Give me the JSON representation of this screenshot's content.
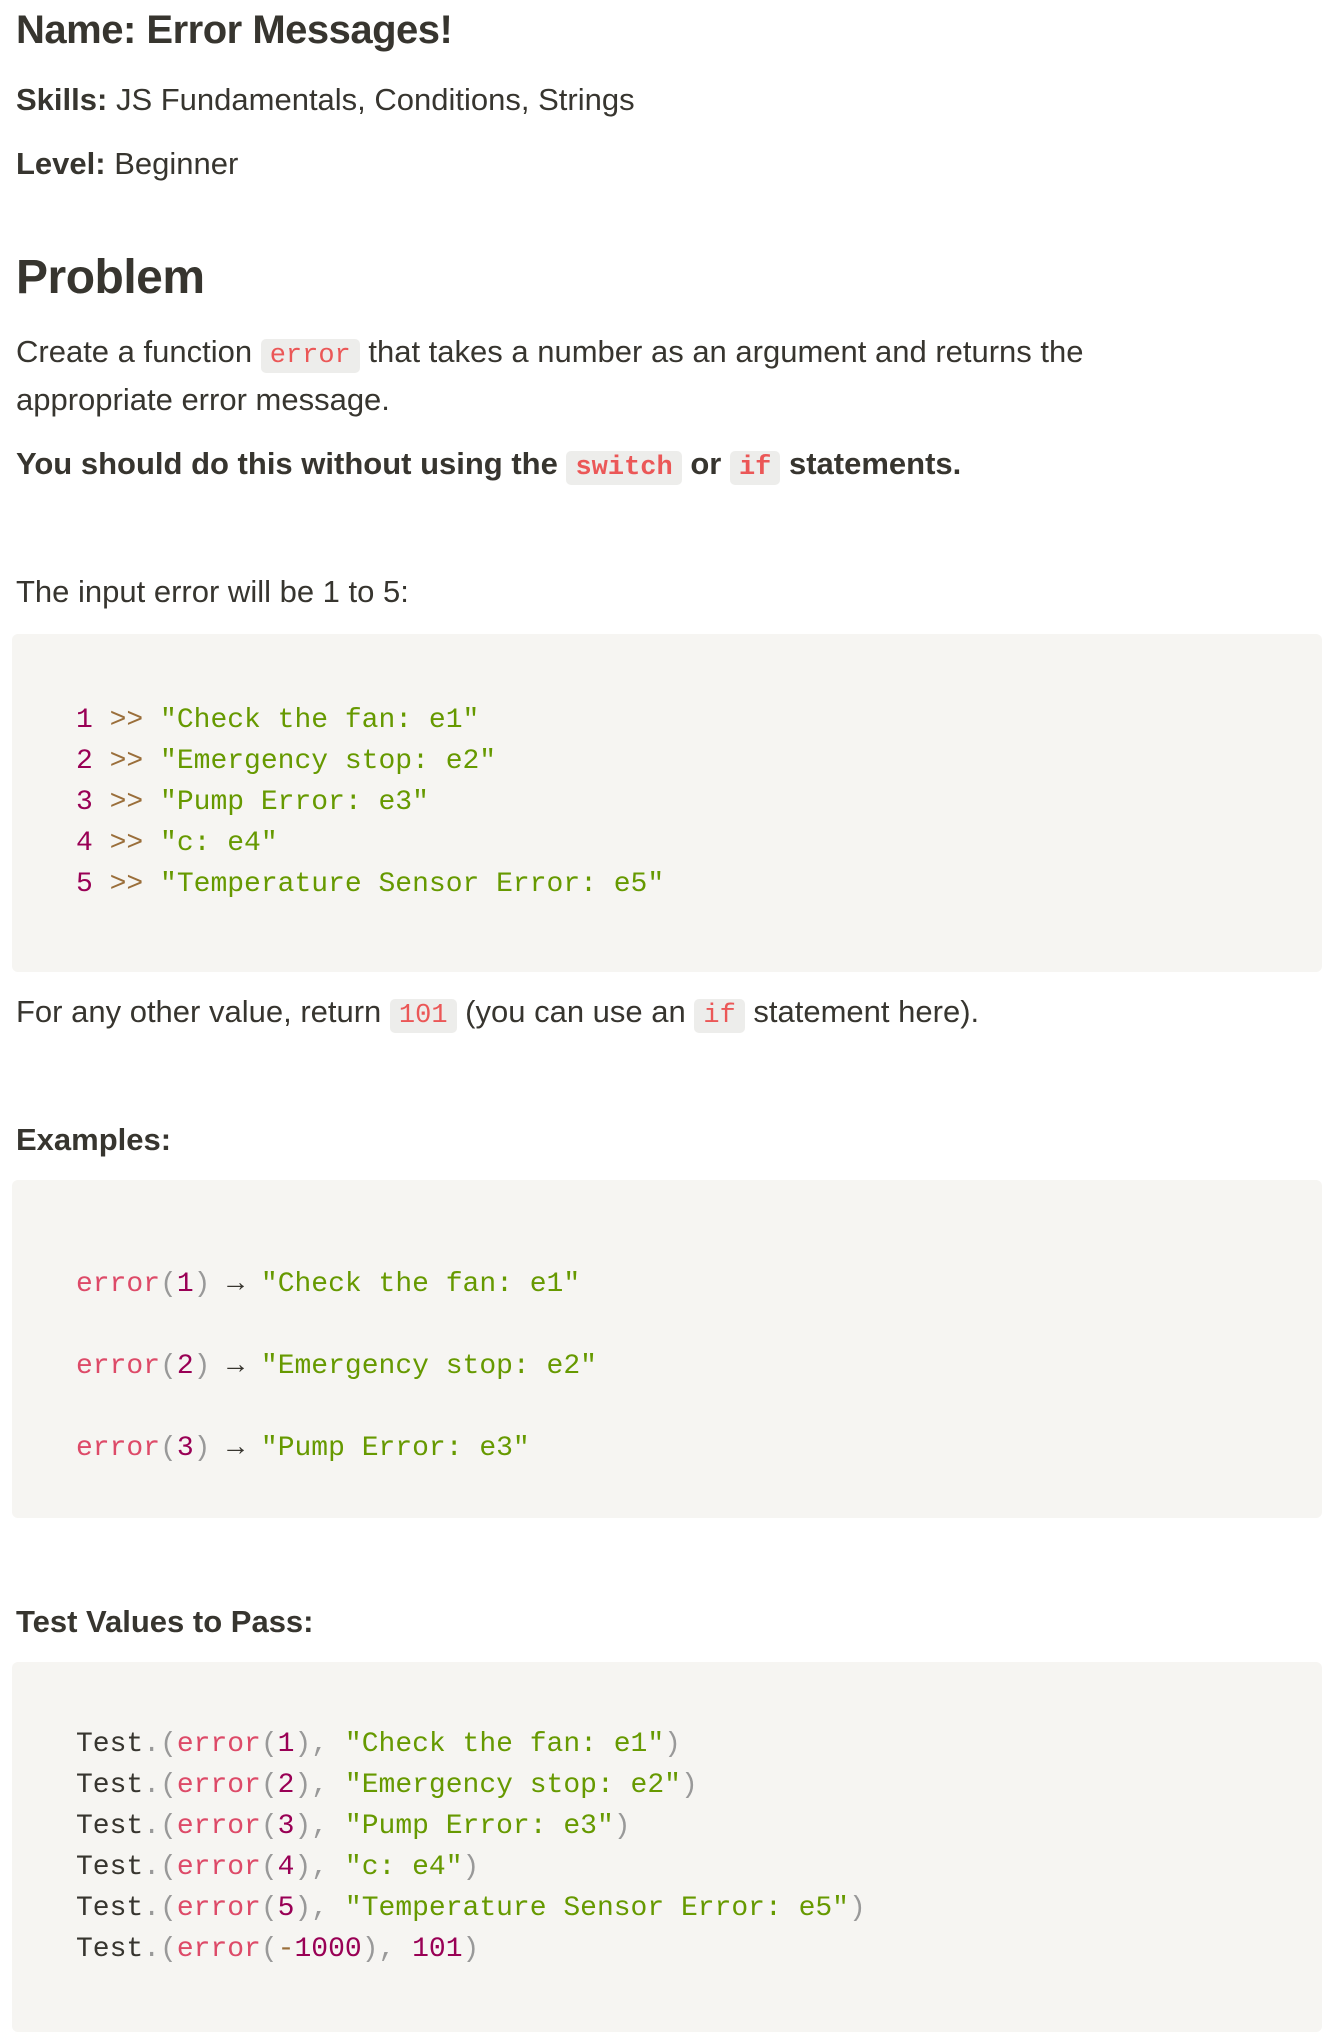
{
  "header": {
    "name_label": "Name:",
    "name_value": "Error Messages!",
    "skills_label": "Skills:",
    "skills_value": "JS Fundamentals, Conditions, Strings",
    "level_label": "Level:",
    "level_value": "Beginner"
  },
  "problem": {
    "heading": "Problem",
    "p1_before": "Create a function",
    "p1_code": "error",
    "p1_after": "that takes a number as an argument and returns the",
    "p1_line2": "appropriate error message.",
    "p2_before": "You should do this without using the",
    "p2_code1": "switch",
    "p2_mid": "or",
    "p2_code2": "if",
    "p2_after": "statements."
  },
  "input_section": {
    "intro": "The input error will be 1 to 5:",
    "arrow": ">>",
    "mappings": [
      {
        "num": "1",
        "message": "\"Check the fan: e1\""
      },
      {
        "num": "2",
        "message": "\"Emergency stop: e2\""
      },
      {
        "num": "3",
        "message": "\"Pump Error: e3\""
      },
      {
        "num": "4",
        "message": "\"c: e4\""
      },
      {
        "num": "5",
        "message": "\"Temperature Sensor Error: e5\""
      }
    ],
    "other_before": "For any other value, return",
    "other_code": "101",
    "other_mid": "(you can use an",
    "other_code2": "if",
    "other_after": "statement here)."
  },
  "examples": {
    "heading": "Examples:",
    "arrow": "→",
    "items": [
      {
        "fn": "error",
        "arg": "1",
        "result": "\"Check the fan: e1\""
      },
      {
        "fn": "error",
        "arg": "2",
        "result": "\"Emergency stop: e2\""
      },
      {
        "fn": "error",
        "arg": "3",
        "result": "\"Pump Error: e3\""
      }
    ]
  },
  "tests": {
    "heading": "Test Values to Pass:",
    "obj": "Test",
    "dot": ".",
    "fn": "error",
    "items": [
      {
        "arg": "1",
        "expected": "\"Check the fan: e1\"",
        "expected_type": "string"
      },
      {
        "arg": "2",
        "expected": "\"Emergency stop: e2\"",
        "expected_type": "string"
      },
      {
        "arg": "3",
        "expected": "\"Pump Error: e3\"",
        "expected_type": "string"
      },
      {
        "arg": "4",
        "expected": "\"c: e4\"",
        "expected_type": "string"
      },
      {
        "arg": "5",
        "expected": "\"Temperature Sensor Error: e5\"",
        "expected_type": "string"
      },
      {
        "arg": "-1000",
        "expected": "101",
        "expected_type": "number"
      }
    ]
  },
  "colors": {
    "text": "#37352f",
    "inline_code": "#eb5757",
    "code_bg": "#f6f5f2",
    "number": "#990055",
    "string": "#669900",
    "function": "#dd4a68",
    "operator": "#9a6e3a",
    "punctuation": "#999999"
  }
}
